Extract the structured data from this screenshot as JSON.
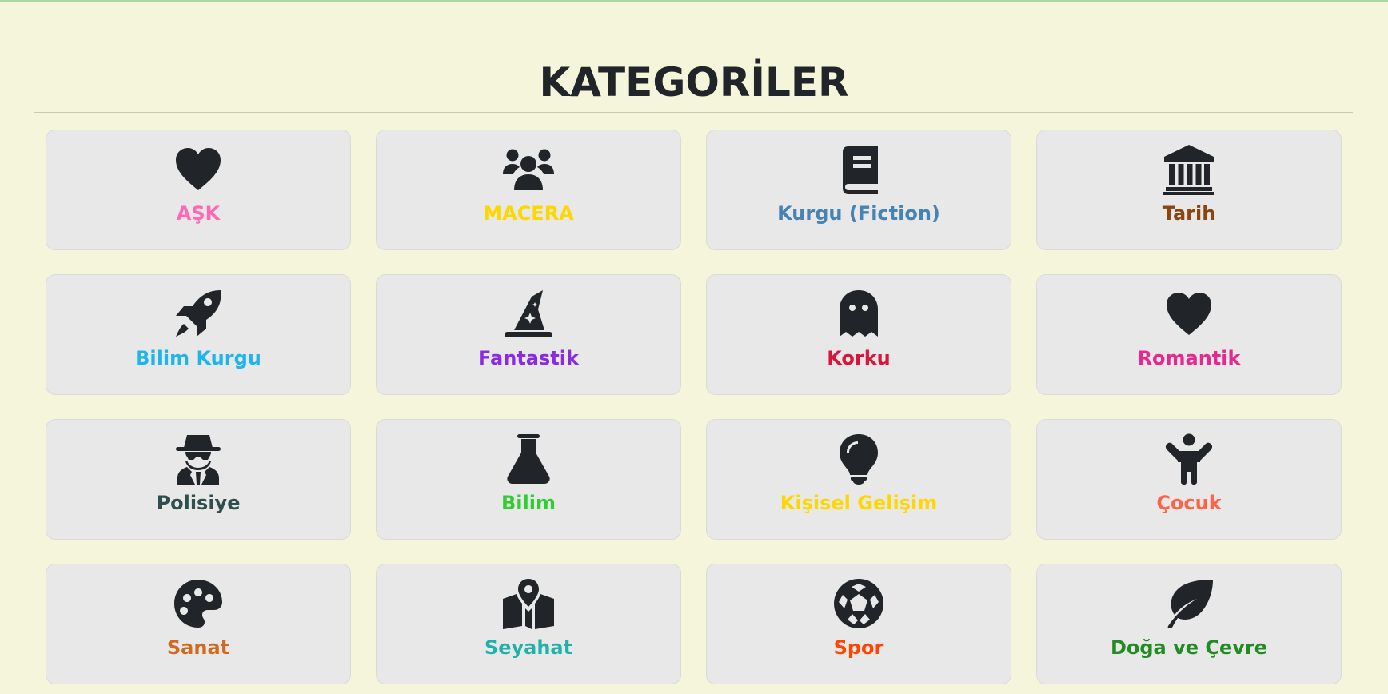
{
  "page": {
    "title": "KATEGORİLER"
  },
  "categories": [
    {
      "label": "AŞK",
      "icon": "heart-icon",
      "color": "#ff69b4"
    },
    {
      "label": "MACERA",
      "icon": "users-icon",
      "color": "#ffd700"
    },
    {
      "label": "Kurgu (Fiction)",
      "icon": "book-icon",
      "color": "#4682b4"
    },
    {
      "label": "Tarih",
      "icon": "landmark-icon",
      "color": "#8b4513"
    },
    {
      "label": "Bilim Kurgu",
      "icon": "rocket-icon",
      "color": "#1eb4ee"
    },
    {
      "label": "Fantastik",
      "icon": "wizard-hat-icon",
      "color": "#8a2be2"
    },
    {
      "label": "Korku",
      "icon": "ghost-icon",
      "color": "#dc143c"
    },
    {
      "label": "Romantik",
      "icon": "heart-icon",
      "color": "#e6298f"
    },
    {
      "label": "Polisiye",
      "icon": "detective-icon",
      "color": "#2f4f4f"
    },
    {
      "label": "Bilim",
      "icon": "flask-icon",
      "color": "#32cd32"
    },
    {
      "label": "Kişisel Gelişim",
      "icon": "lightbulb-icon",
      "color": "#ffd700"
    },
    {
      "label": "Çocuk",
      "icon": "child-icon",
      "color": "#ff6347"
    },
    {
      "label": "Sanat",
      "icon": "palette-icon",
      "color": "#d2691e"
    },
    {
      "label": "Seyahat",
      "icon": "map-location-icon",
      "color": "#20b2aa"
    },
    {
      "label": "Spor",
      "icon": "soccer-ball-icon",
      "color": "#ff4500"
    },
    {
      "label": "Doğa ve Çevre",
      "icon": "leaf-icon",
      "color": "#228b22"
    }
  ]
}
